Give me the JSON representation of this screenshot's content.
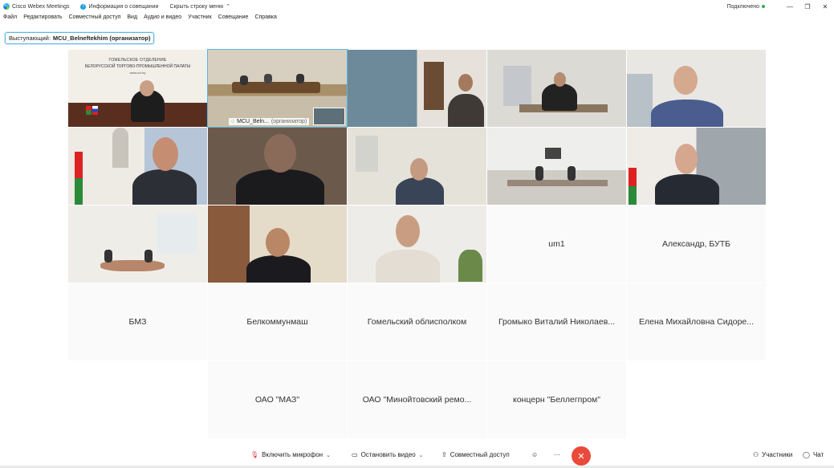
{
  "titlebar": {
    "app_name": "Cisco Webex Meetings",
    "info_label": "Информация о совещании",
    "hide_menu_label": "Скрыть строку меню",
    "connection_status": "Подключено",
    "minimize": "—",
    "restore": "❐",
    "close": "✕"
  },
  "menu": [
    "Файл",
    "Редактировать",
    "Совместный доступ",
    "Вид",
    "Аудио и видео",
    "Участник",
    "Совещание",
    "Справка"
  ],
  "speaker": {
    "prefix": "Выступающий:",
    "name": "MCU_Belneftekhim (организатор)"
  },
  "active_tile": {
    "name": "MCU_Beln...",
    "role": "(организатор)"
  },
  "name_tiles": [
    "um1",
    "Александр, БУТБ",
    "БМЗ",
    "Белкоммунмаш",
    "Гомельский облисполком",
    "Громыко Виталий Николаев...",
    "Елена Михайловна Сидоре...",
    "ОАО \"МАЗ\"",
    "ОАО \"Минойтовский ремо...",
    "концерн \"Беллегпром\""
  ],
  "video_texts": {
    "gomel_sign_1": "ГОМЕЛЬСКОЕ ОТДЕЛЕНИЕ",
    "gomel_sign_2": "БЕЛОРУССКОЙ ТОРГОВО-ПРОМЫШЛЕННОЙ ПАЛАТЫ",
    "gomel_sign_3": "www.cci.by"
  },
  "controls": {
    "mic": "Включить микрофон",
    "video": "Остановить видео",
    "share": "Совместный доступ",
    "more": "···",
    "participants": "Участники",
    "chat": "Чат"
  },
  "colors": {
    "accent": "#5ab8e0",
    "end_call": "#ea4a3a",
    "connected": "#2bb04a"
  }
}
